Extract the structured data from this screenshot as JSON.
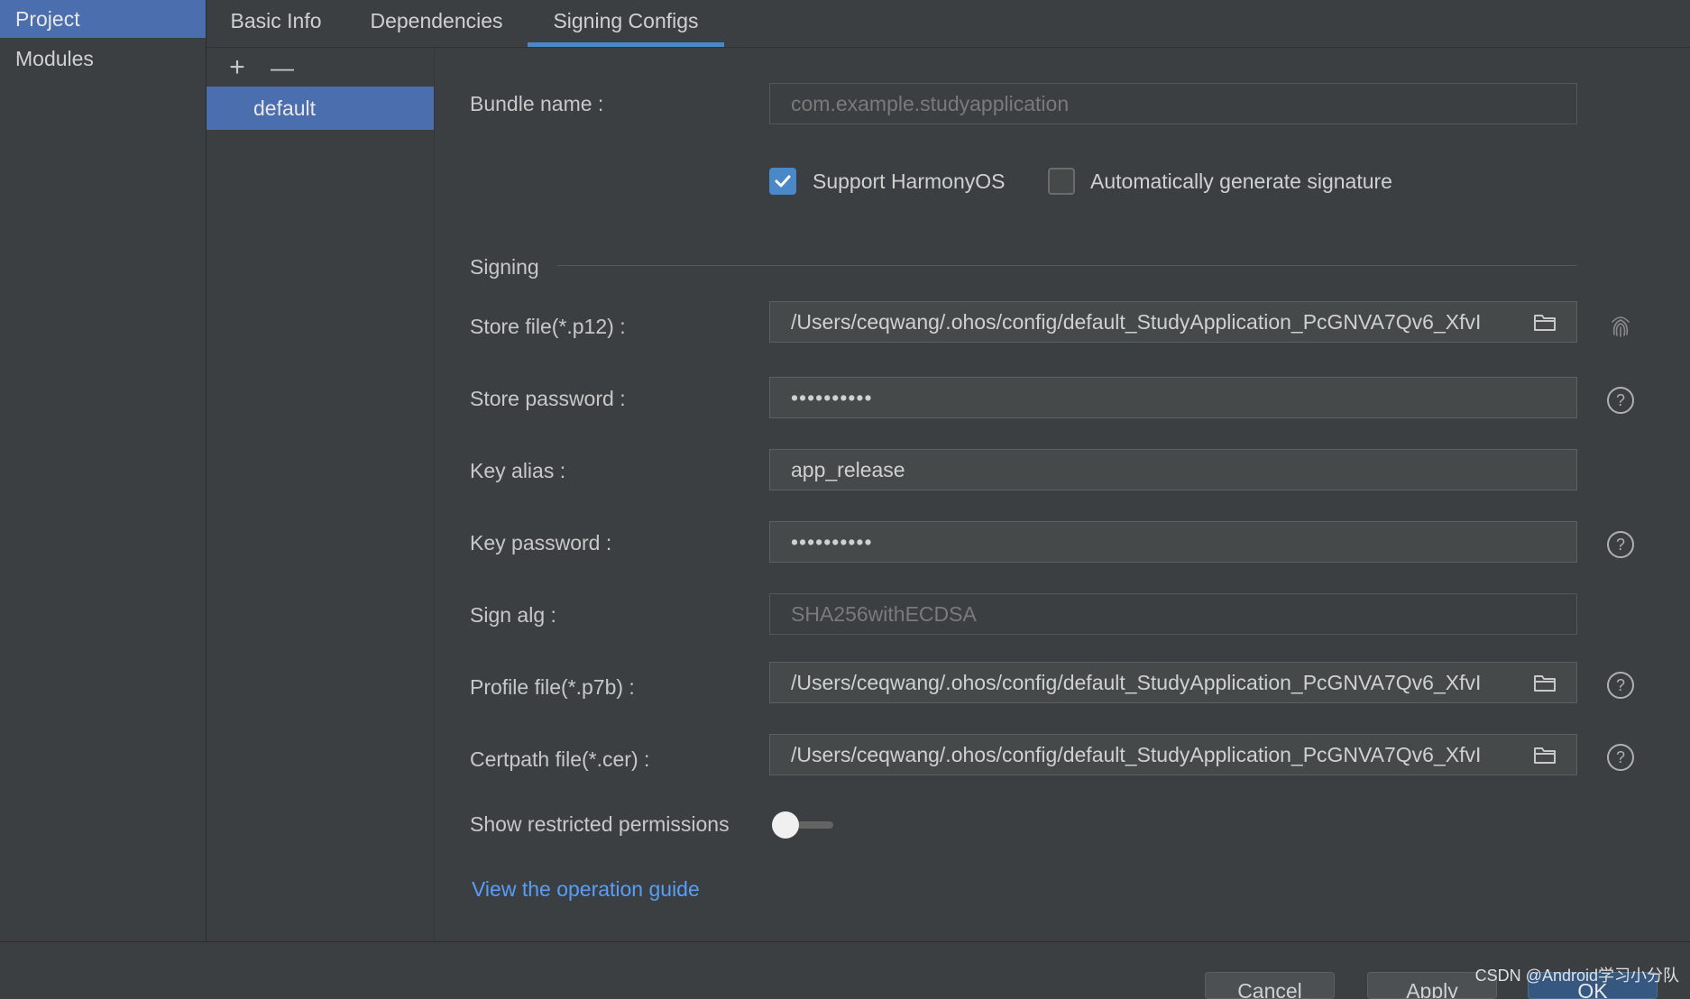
{
  "sidebar": {
    "items": [
      {
        "label": "Project",
        "active": true
      },
      {
        "label": "Modules",
        "active": false
      }
    ]
  },
  "tabs": [
    {
      "label": "Basic Info"
    },
    {
      "label": "Dependencies"
    },
    {
      "label": "Signing Configs",
      "active": true
    }
  ],
  "configs": {
    "add_label": "+",
    "remove_label": "—",
    "items": [
      "default"
    ]
  },
  "form": {
    "bundle_name_label": "Bundle name :",
    "bundle_name_placeholder": "com.example.studyapplication",
    "support_harmonyos_label": "Support HarmonyOS",
    "support_harmonyos_checked": true,
    "auto_signature_label": "Automatically generate signature",
    "auto_signature_checked": false,
    "signing_section_label": "Signing",
    "store_file_label": "Store file(*.p12) :",
    "store_file_value": "/Users/ceqwang/.ohos/config/default_StudyApplication_PcGNVA7Qv6_XfvI",
    "store_password_label": "Store password :",
    "store_password_value": "••••••••••",
    "key_alias_label": "Key alias :",
    "key_alias_value": "app_release",
    "key_password_label": "Key password :",
    "key_password_value": "••••••••••",
    "sign_alg_label": "Sign alg :",
    "sign_alg_value": "SHA256withECDSA",
    "profile_file_label": "Profile file(*.p7b) :",
    "profile_file_value": "/Users/ceqwang/.ohos/config/default_StudyApplication_PcGNVA7Qv6_XfvI",
    "certpath_file_label": "Certpath file(*.cer) :",
    "certpath_file_value": "/Users/ceqwang/.ohos/config/default_StudyApplication_PcGNVA7Qv6_XfvI",
    "show_restricted_label": "Show restricted permissions",
    "show_restricted_on": false,
    "guide_link": "View the operation guide"
  },
  "footer": {
    "cancel_label": "Cancel",
    "apply_label": "Apply",
    "ok_label": "OK"
  },
  "watermark": "CSDN @Android学习小分队",
  "colors": {
    "accent": "#4b6eaf",
    "tab_underline": "#4a88c7",
    "link": "#589df6",
    "background": "#3c3f41"
  }
}
